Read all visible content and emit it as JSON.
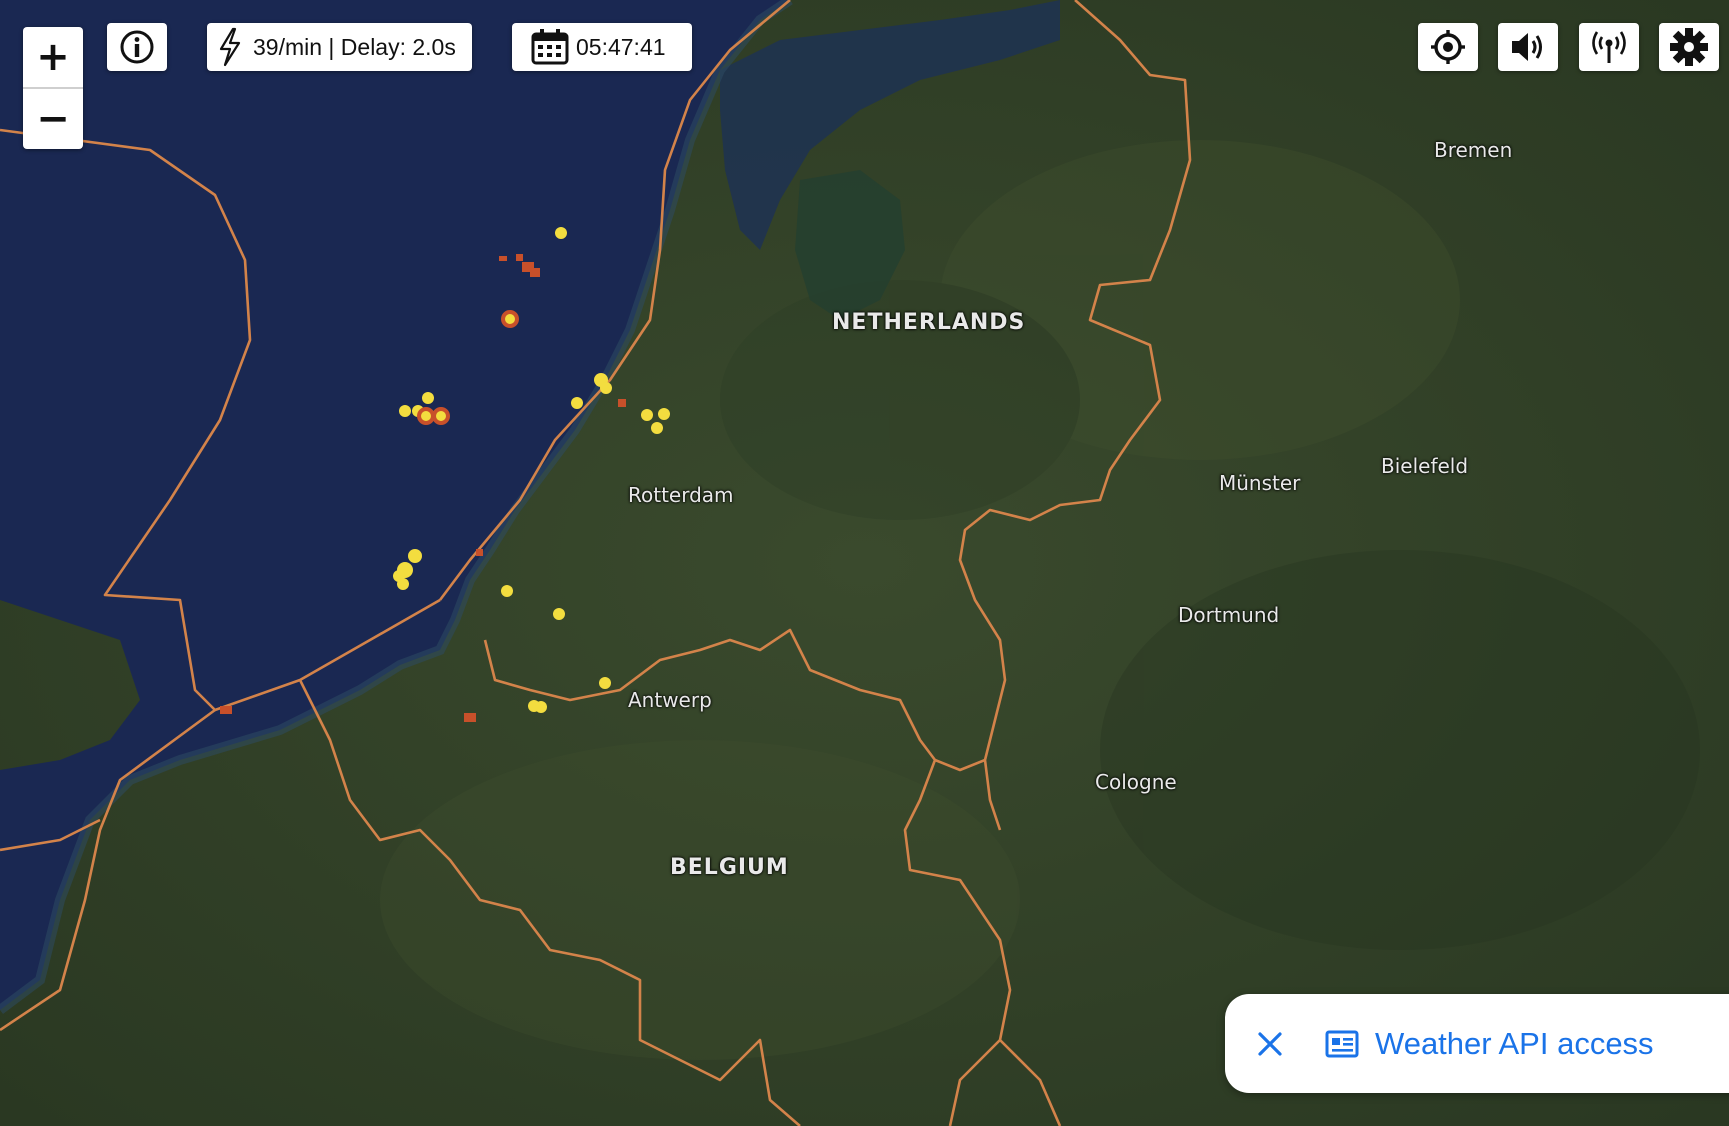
{
  "toolbar": {
    "rate_text": "39/min | Delay: 2.0s",
    "time_text": "05:47:41",
    "zoom_in_label": "+",
    "zoom_out_label": "−"
  },
  "map_labels": {
    "netherlands": "NETHERLANDS",
    "belgium": "BELGIUM",
    "rotterdam": "Rotterdam",
    "antwerp": "Antwerp",
    "bremen": "Bremen",
    "munster": "Münster",
    "bielefeld": "Bielefeld",
    "dortmund": "Dortmund",
    "cologne": "Cologne"
  },
  "toast": {
    "text": "Weather API access"
  },
  "colors": {
    "sea": "#1a2852",
    "land": "#33422a",
    "border": "#d3834a",
    "strike_recent": "#f3dd3f",
    "strike_old": "#c8502a",
    "link_blue": "#1a73e8"
  }
}
